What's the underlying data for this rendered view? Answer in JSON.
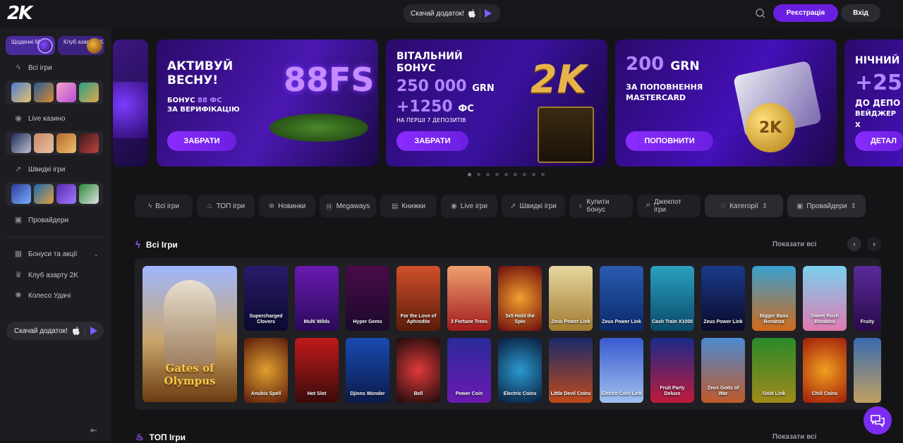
{
  "header": {
    "logo": "2K",
    "app_label": "Скачай додаток!",
    "register": "Реєстрація",
    "login": "Вхід"
  },
  "sidebar": {
    "promo1": "Щоденні Місії",
    "promo2": "Клуб азарту 2K",
    "items": [
      {
        "label": "Всі ігри",
        "icon": "bolt-icon"
      },
      {
        "label": "Live казино",
        "icon": "live-icon"
      },
      {
        "label": "Швидкі ігри",
        "icon": "rocket-icon"
      },
      {
        "label": "Провайдери",
        "icon": "gamepad-icon"
      }
    ],
    "bonuses": "Бонуси та акції",
    "club": "Клуб азарту 2K",
    "wheel": "Колесо Удачі",
    "app_label": "Скачай додаток!"
  },
  "banners": [
    {
      "title1": "АКТИВУЙ",
      "title2": "ВЕСНУ!",
      "sub1": "БОНУС",
      "sub1_accent": "88 ФС",
      "sub2": "ЗА ВЕРИФІКАЦІЮ",
      "button": "ЗАБРАТИ",
      "badge": "88FS"
    },
    {
      "title1": "ВІТАЛЬНИЙ",
      "title2": "БОНУС",
      "amount": "250 000",
      "currency": "GRN",
      "fs": "+1250",
      "fs_unit": "ФС",
      "note": "НА ПЕРШІ 7 ДЕПОЗИТІВ",
      "button": "ЗАБРАТИ",
      "badge": "2K"
    },
    {
      "amount": "200",
      "currency": "GRN",
      "sub1": "ЗА ПОПОВНЕННЯ",
      "sub2": "MASTERCARD",
      "button": "ПОПОВНИТИ",
      "badge": "2K"
    },
    {
      "title1": "НІЧНИЙ",
      "amount": "+25",
      "sub1": "ДО ДЕПО",
      "sub2": "ВЕЙДЖЕР Х",
      "button": "ДЕТАЛ"
    }
  ],
  "filters": [
    {
      "label": "Всі ігри",
      "icon": "bolt-icon"
    },
    {
      "label": "ТОП ігри",
      "icon": "fire-icon"
    },
    {
      "label": "Новинки",
      "icon": "new-icon"
    },
    {
      "label": "Megaways",
      "icon": "megaways-icon"
    },
    {
      "label": "Книжки",
      "icon": "book-icon"
    },
    {
      "label": "Live ігри",
      "icon": "live-icon"
    },
    {
      "label": "Швидкі ігри",
      "icon": "rocket-icon"
    },
    {
      "label": "Купити бонус",
      "icon": "bag-icon"
    },
    {
      "label": "Джекпот ігри",
      "icon": "jackpot-icon"
    },
    {
      "label": "Категорії",
      "icon": "grid-icon"
    },
    {
      "label": "Провайдери",
      "icon": "provider-icon"
    }
  ],
  "all_games": {
    "title": "Всі Ігри",
    "show_all": "Показати всі",
    "featured": "Gates of Olympus",
    "row1": [
      "Supercharged Clovers",
      "Multi Wilds",
      "Hyper Gems",
      "For the Love of Aphrodite",
      "3 Fortune Trees",
      "3x5 Hold the Spin",
      "Zeus Power Link",
      "Zeus Power Link",
      "Cash Train X1000",
      "Zeus Power Link",
      "Bigger Bass Bonanza",
      "Sweet Rush Bonanza",
      "Fruity"
    ],
    "row2": [
      "Anubis Spell",
      "Hot Slot",
      "Djinns Wonder",
      "Bell",
      "Power Coin",
      "Electric Coins",
      "Little Devil Coins",
      "Electro Coin Link",
      "Fruit Party Deluxe",
      "Zeus Gods of War",
      "Gold Link",
      "Chili Coins",
      ""
    ]
  },
  "top_games": {
    "title": "ТОП Ігри",
    "show_all": "Показати всі"
  }
}
